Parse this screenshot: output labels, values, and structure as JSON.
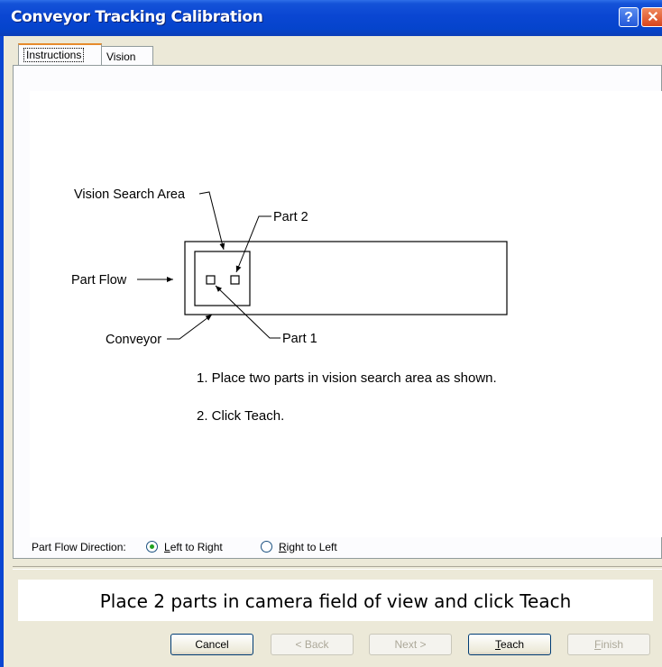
{
  "window": {
    "title": "Conveyor Tracking Calibration"
  },
  "tabs": [
    {
      "label": "Instructions",
      "selected": true
    },
    {
      "label": "Vision",
      "selected": false
    }
  ],
  "diagram": {
    "labels": {
      "vision_search_area": "Vision Search Area",
      "part2": "Part 2",
      "part_flow": "Part Flow",
      "conveyor": "Conveyor",
      "part1": "Part 1"
    }
  },
  "instructions": {
    "step1": "1. Place two parts in vision search area as shown.",
    "step2": "2. Click Teach."
  },
  "part_flow_direction": {
    "label": "Part Flow Direction:",
    "options": [
      {
        "label": "Left to Right",
        "mnemonic": "L",
        "rest": "eft to Right",
        "checked": true
      },
      {
        "label": "Right to Left",
        "mnemonic": "R",
        "rest": "ight to Left",
        "checked": false
      }
    ]
  },
  "status": {
    "message": "Place 2 parts in camera field of view and click Teach"
  },
  "buttons": {
    "cancel": "Cancel",
    "back": "< Back",
    "next": "Next >",
    "teach": "Teach",
    "finish": "Finish"
  },
  "colors": {
    "titlebar": "#0a46d2",
    "tab_highlight": "#e68b2c",
    "radio_dot": "#21a121"
  }
}
